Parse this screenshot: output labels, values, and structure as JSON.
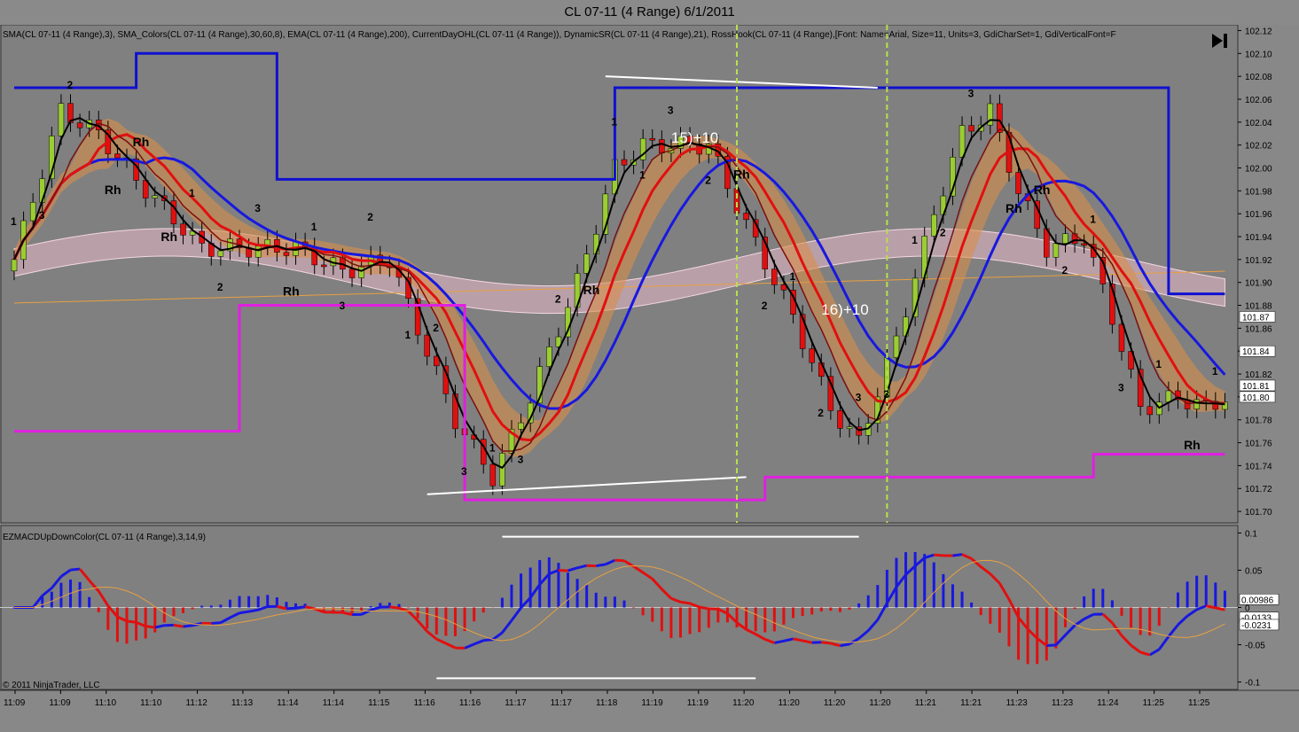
{
  "window": {
    "title": "CL 07-11 (4 Range)  6/1/2011",
    "indicators_line": "SMA(CL 07-11 (4 Range),3), SMA_Colors(CL 07-11 (4 Range),30,60,8), EMA(CL 07-11 (4 Range),200), CurrentDayOHL(CL 07-11 (4 Range)), DynamicSR(CL 07-11 (4 Range),21), RossHook(CL 07-11 (4 Range),[Font: Name=Arial, Size=11, Units=3, GdiCharSet=1, GdiVerticalFont=F",
    "lower_panel_label": "EZMACDUpDownColor(CL 07-11 (4 Range),3,14,9)",
    "copyright": "© 2011 NinjaTrader, LLC",
    "play_icon": "skip-to-end-icon"
  },
  "colors": {
    "background": "#808080",
    "up_bar": "#9ACD32",
    "down_bar": "#E01010",
    "resistance": "#1010D0",
    "support": "#E020E0",
    "sma3": "#000000",
    "ema200": "#E8A040",
    "macd_up": "#1818E0",
    "macd_down": "#E01010"
  },
  "chart_data": [
    {
      "type": "candlestick",
      "title": "CL 07-11 (4 Range)  6/1/2011",
      "y_ticks": [
        "102.12",
        "102.10",
        "102.08",
        "102.06",
        "102.04",
        "102.02",
        "102.00",
        "101.98",
        "101.96",
        "101.94",
        "101.92",
        "101.90",
        "101.88",
        "101.86",
        "101.84",
        "101.82",
        "101.80",
        "101.78",
        "101.76",
        "101.74",
        "101.72",
        "101.70"
      ],
      "ylim": [
        101.69,
        102.125
      ],
      "x_ticks": [
        "11:09",
        "11:09",
        "11:10",
        "11:10",
        "11:12",
        "11:13",
        "11:14",
        "11:14",
        "11:15",
        "11:16",
        "11:16",
        "11:17",
        "11:17",
        "11:18",
        "11:19",
        "11:19",
        "11:20",
        "11:20",
        "11:20",
        "11:20",
        "11:21",
        "11:21",
        "11:23",
        "11:23",
        "11:24",
        "11:25",
        "11:25"
      ],
      "price_labels": [
        {
          "text": "101.87",
          "value": 101.87
        },
        {
          "text": "101.84",
          "value": 101.84
        },
        {
          "text": "101.81",
          "value": 101.81
        },
        {
          "text": "101.80",
          "value": 101.8
        }
      ],
      "resistance_levels": [
        102.07,
        102.1,
        101.99,
        102.07,
        101.89
      ],
      "support_levels": [
        101.77,
        101.88,
        101.71,
        101.73,
        101.75
      ],
      "annotations": [
        "15)+10",
        "16)+10"
      ],
      "rh_labels": [
        "1",
        "3",
        "2",
        "Rh",
        "Rh",
        "Rh",
        "1",
        "2",
        "3",
        "Rh",
        "1",
        "3",
        "2",
        "1",
        "2",
        "3",
        "1",
        "3",
        "2",
        "Rh",
        "1",
        "1",
        "3",
        "2",
        "Rh",
        "2",
        "1",
        "2",
        "3",
        "3",
        "1",
        "2",
        "3",
        "Rh",
        "Rh",
        "2",
        "1",
        "3",
        "1",
        "Rh",
        "1"
      ]
    },
    {
      "type": "bar",
      "title": "EZMACDUpDownColor(CL 07-11 (4 Range),3,14,9)",
      "y_ticks": [
        "0.1",
        "0.05",
        "0",
        "-0.05",
        "-0.1"
      ],
      "ylim": [
        -0.11,
        0.11
      ],
      "value_labels": [
        "0.00986",
        "-0.0133",
        "-0.0231"
      ]
    }
  ]
}
